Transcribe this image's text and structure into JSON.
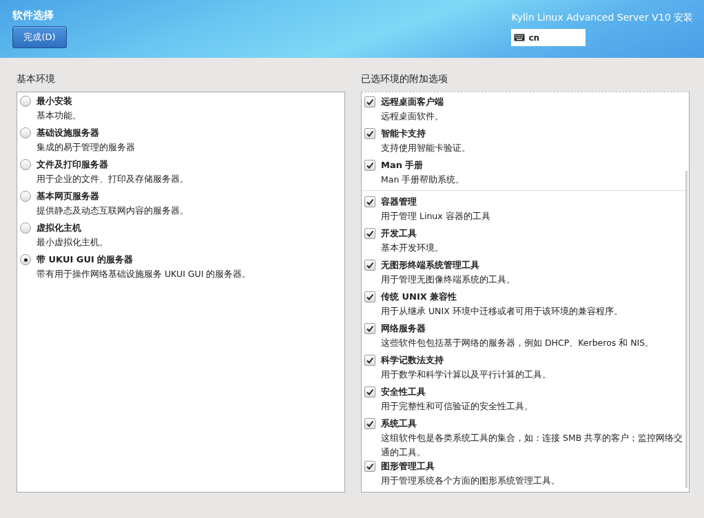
{
  "header": {
    "title": "软件选择",
    "done_button": "完成(D)",
    "product": "Kylin Linux Advanced Server V10 安装",
    "keyboard": {
      "value": "cn"
    }
  },
  "base_environment": {
    "label": "基本环境",
    "items": [
      {
        "title": "最小安装",
        "description": "基本功能。",
        "selected": false
      },
      {
        "title": "基础设施服务器",
        "description": "集成的易于管理的服务器",
        "selected": false
      },
      {
        "title": "文件及打印服务器",
        "description": "用于企业的文件、打印及存储服务器。",
        "selected": false
      },
      {
        "title": "基本网页服务器",
        "description": "提供静态及动态互联网内容的服务器。",
        "selected": false
      },
      {
        "title": "虚拟化主机",
        "description": "最小虚拟化主机。",
        "selected": false
      },
      {
        "title": "带 UKUI GUI 的服务器",
        "description": "带有用于操作网络基础设施服务 UKUI GUI 的服务器。",
        "selected": true
      }
    ]
  },
  "addons": {
    "label": "已选环境的附加选项",
    "groups": [
      [
        {
          "title": "远程桌面客户端",
          "description": "远程桌面软件。",
          "checked": true
        },
        {
          "title": "智能卡支持",
          "description": "支持使用智能卡验证。",
          "checked": true
        },
        {
          "title": "Man 手册",
          "description": "Man 手册帮助系统。",
          "checked": true
        }
      ],
      [
        {
          "title": "容器管理",
          "description": "用于管理 Linux 容器的工具",
          "checked": true
        },
        {
          "title": "开发工具",
          "description": "基本开发环境。",
          "checked": true
        },
        {
          "title": "无图形终端系统管理工具",
          "description": "用于管理无图像终端系统的工具。",
          "checked": true
        },
        {
          "title": "传统 UNIX 兼容性",
          "description": "用于从继承 UNIX 环境中迁移或者可用于该环境的兼容程序。",
          "checked": true
        },
        {
          "title": "网络服务器",
          "description": "这些软件包包括基于网络的服务器，例如 DHCP、Kerberos 和 NIS。",
          "checked": true
        },
        {
          "title": "科学记数法支持",
          "description": "用于数学和科学计算以及平行计算的工具。",
          "checked": true
        },
        {
          "title": "安全性工具",
          "description": "用于完整性和可信验证的安全性工具。",
          "checked": true
        },
        {
          "title": "系统工具",
          "description": "这组软件包是各类系统工具的集合，如：连接 SMB 共享的客户；监控网络交通的工具。",
          "checked": true
        },
        {
          "title": "图形管理工具",
          "description": "用于管理系统各个方面的图形系统管理工具。",
          "checked": true
        }
      ]
    ]
  }
}
